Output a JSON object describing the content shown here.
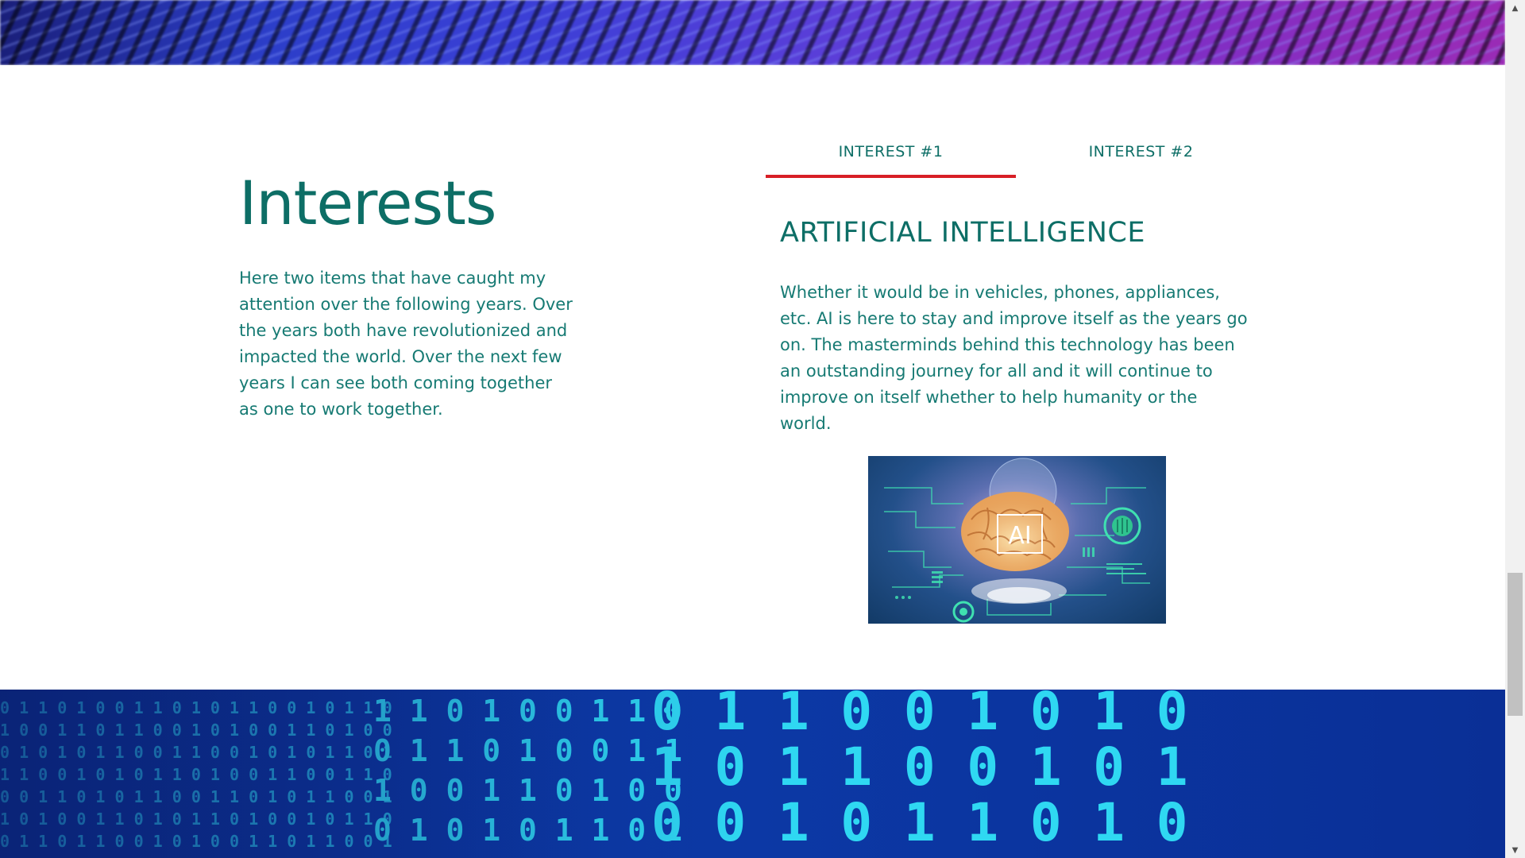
{
  "interests": {
    "title": "Interests",
    "intro": "Here two items that have caught my attention over the following years. Over the years both have revolutionized and impacted the world. Over the next few years I can see both coming together as one to work together."
  },
  "tabs": [
    {
      "label": "INTEREST #1",
      "active": true
    },
    {
      "label": "INTEREST #2",
      "active": false
    }
  ],
  "panel": {
    "title": "ARTIFICIAL INTELLIGENCE",
    "text": "Whether it would be in vehicles, phones, appliances, etc. AI is here to stay and improve itself as the years go on. The masterminds behind this technology has been an outstanding journey for all and it will continue to improve on itself whether to help humanity or the world.",
    "image_text": "AI"
  },
  "colors": {
    "heading": "#0d6e66",
    "body_text": "#167a73",
    "tab_indicator": "#d81f26"
  },
  "scrollbar": {
    "up_icon": "triangle-up",
    "down_icon": "triangle-down"
  }
}
